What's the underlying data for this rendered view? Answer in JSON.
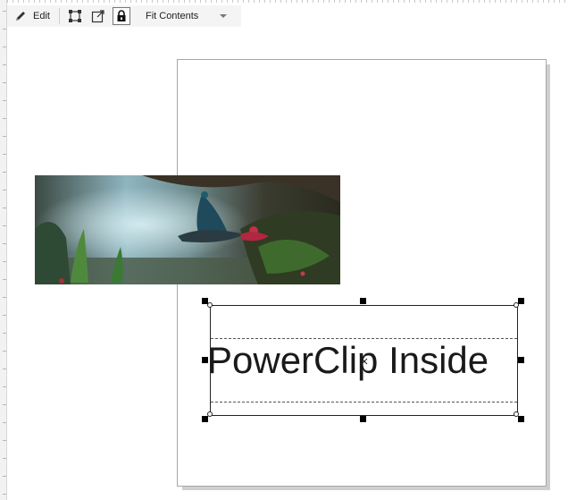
{
  "toolbar": {
    "edit_label": "Edit",
    "icons": [
      "select-frame-icon",
      "extract-contents-icon",
      "lock-contents-icon"
    ],
    "fit_label": "Fit Contents"
  },
  "canvas": {
    "powerclip_text": "PowerClip Inside",
    "bitmap_description_icon": "peacock-bitmap"
  },
  "colors": {
    "toolbar_bg": "#f4f4f4",
    "page_border": "#a7a7a7",
    "handle": "#000000"
  }
}
